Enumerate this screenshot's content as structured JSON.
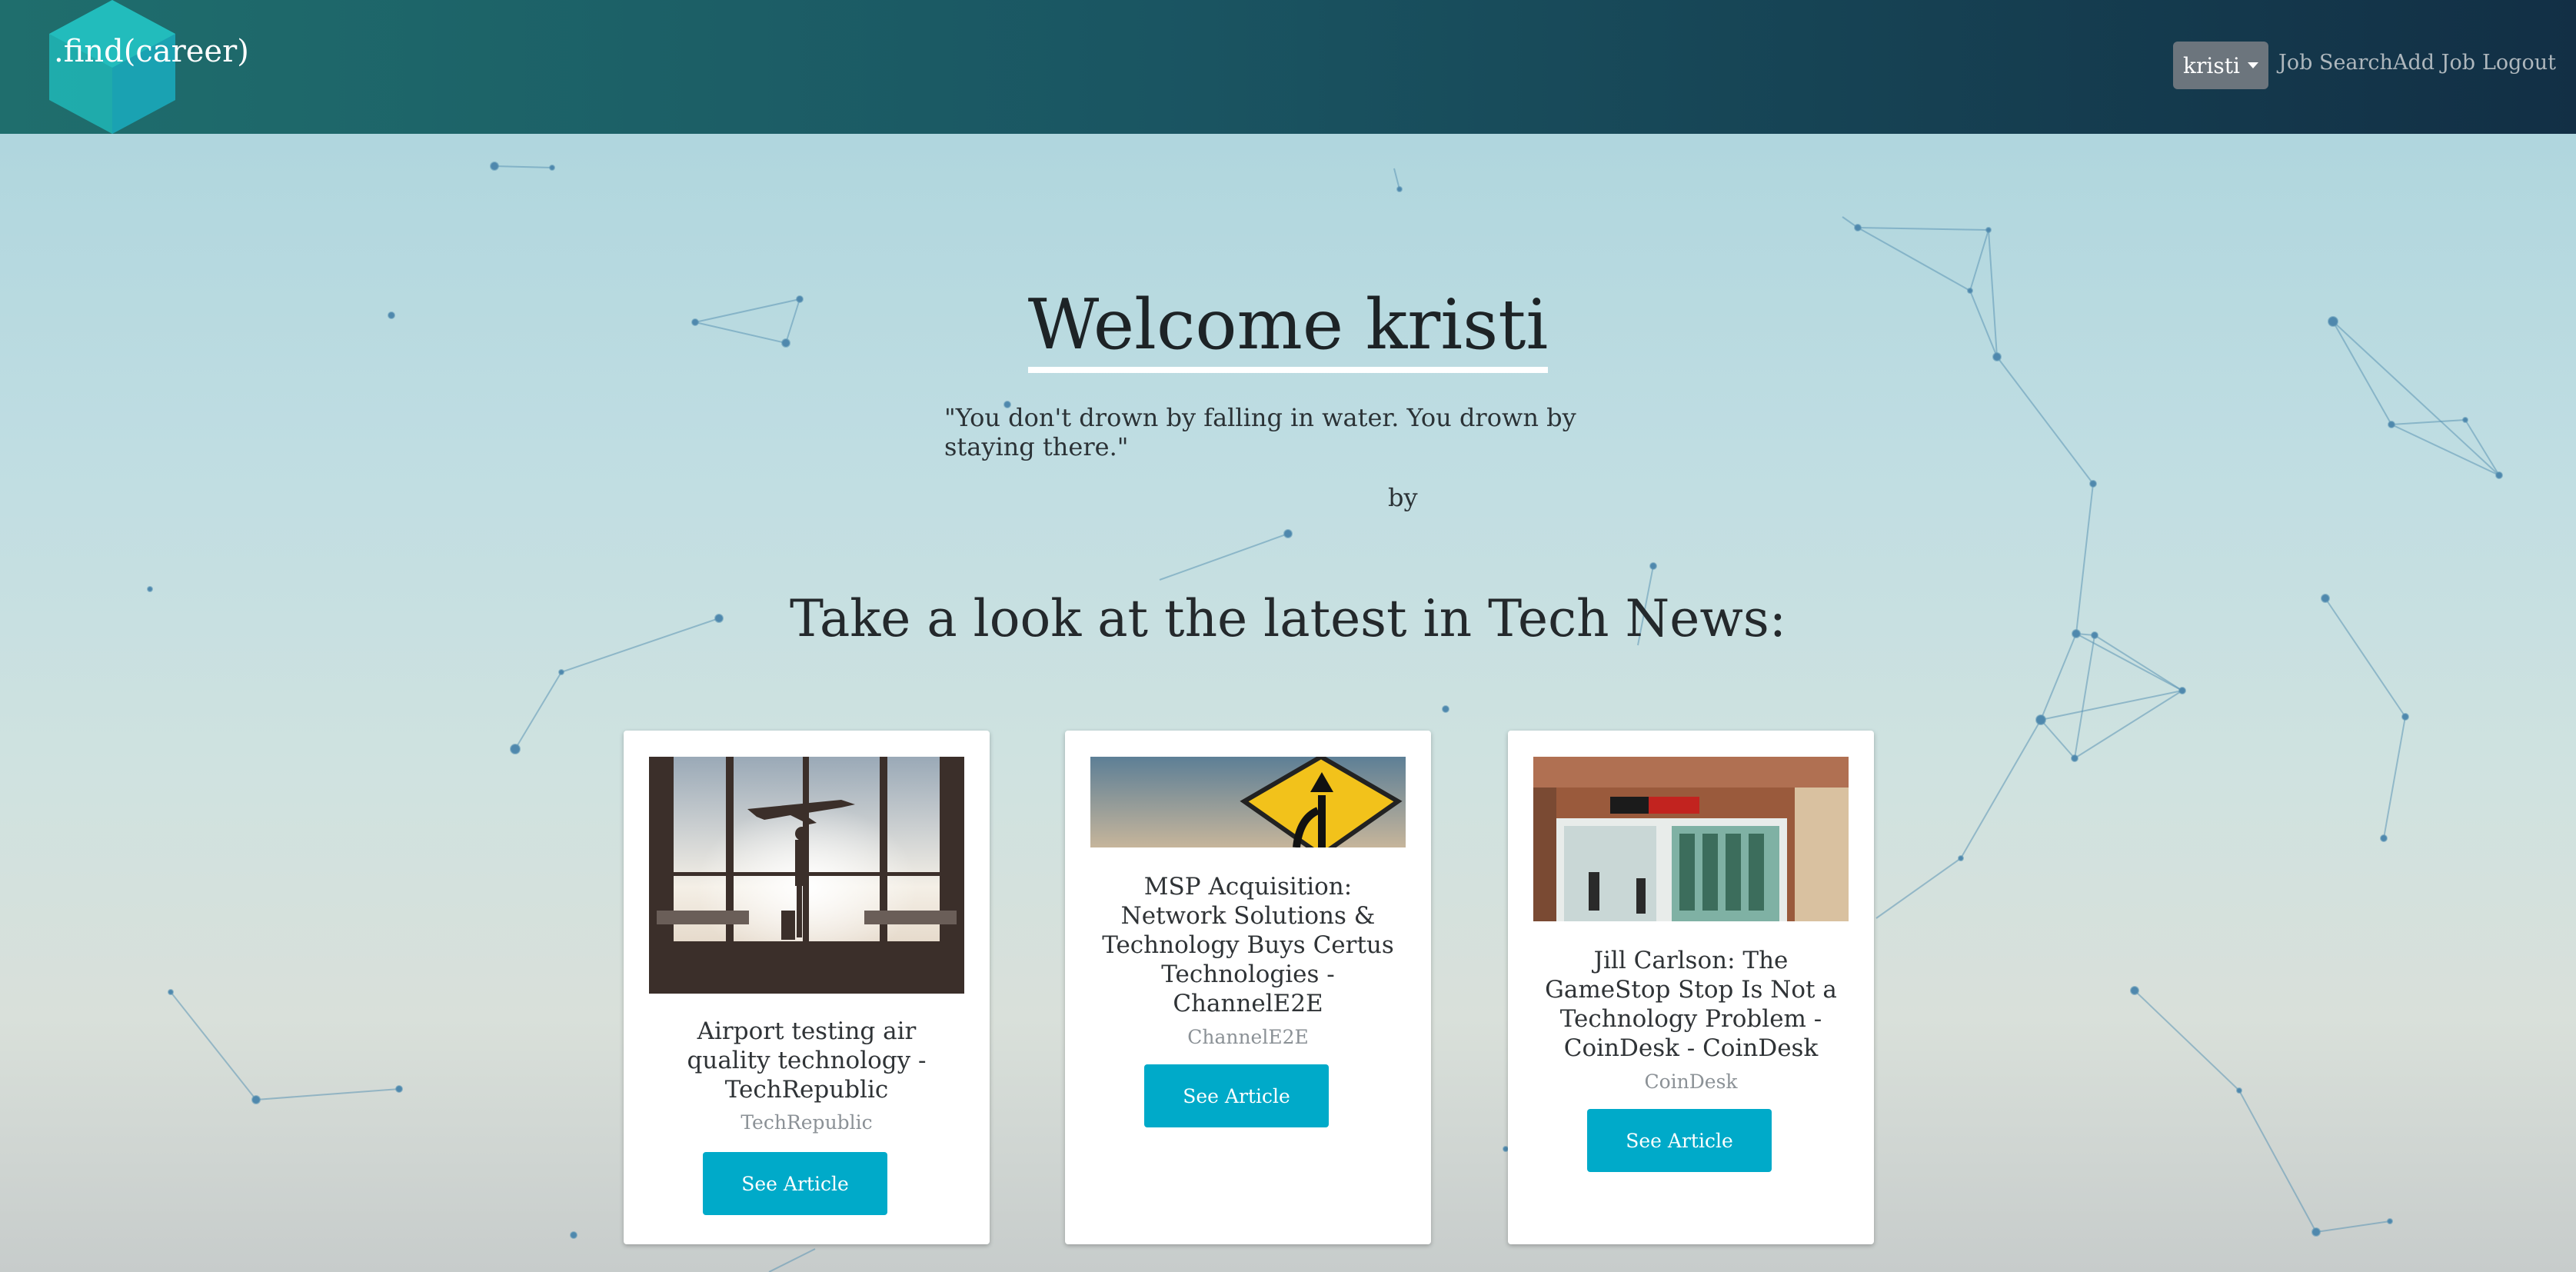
{
  "navbar": {
    "brand": ".find(career)",
    "user_menu_label": "kristi",
    "links": [
      "Job Search",
      "Add Job",
      "Logout"
    ]
  },
  "hero": {
    "welcome": "Welcome kristi",
    "quote": "\"You don't drown by falling in water. You drown by staying there.\"",
    "quote_author": "by"
  },
  "news": {
    "heading": "Take a look at the latest in Tech News:",
    "articles": [
      {
        "title": "Airport testing air quality technology - TechRepublic",
        "source": "TechRepublic",
        "button": "See Article",
        "image": "airport-silhouette-image"
      },
      {
        "title": "MSP Acquisition: Network Solutions & Technology Buys Certus Technologies - ChannelE2E",
        "source": "ChannelE2E",
        "button": "See Article",
        "image": "merge-road-sign-image"
      },
      {
        "title": "Jill Carlson: The GameStop Stop Is Not a Technology Problem - CoinDesk - CoinDesk",
        "source": "CoinDesk",
        "button": "See Article",
        "image": "gamestop-storefront-image"
      }
    ]
  },
  "colors": {
    "navbar_start": "#1f6e6d",
    "navbar_end": "#122f45",
    "button": "#00aac9",
    "user_button": "#6c757d"
  }
}
